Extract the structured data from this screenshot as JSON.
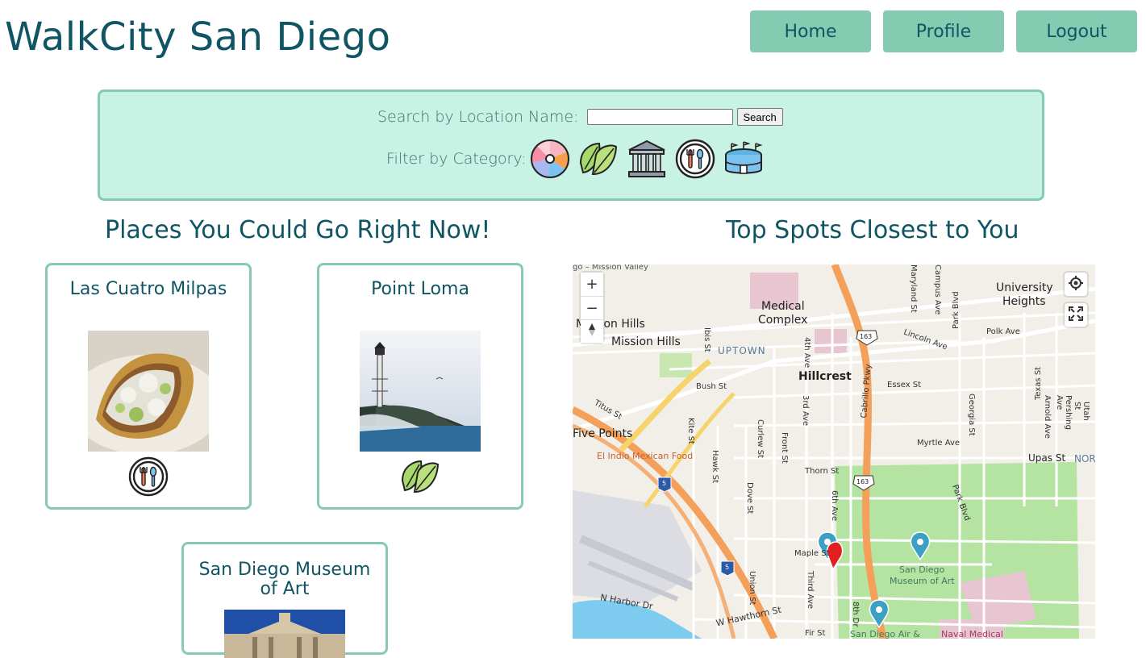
{
  "site": {
    "title": "WalkCity San Diego"
  },
  "nav": {
    "home": "Home",
    "profile": "Profile",
    "logout": "Logout"
  },
  "search": {
    "label": "Search by Location Name:",
    "button": "Search",
    "value": ""
  },
  "filter": {
    "label": "Filter by Category:",
    "categories": [
      "beach-ball-icon",
      "leaves-icon",
      "museum-icon",
      "restaurant-icon",
      "stadium-icon"
    ]
  },
  "sections": {
    "places": "Places You Could Go Right Now!",
    "top_spots": "Top Spots Closest to You"
  },
  "cards": [
    {
      "title": "Las Cuatro Milpas",
      "category": "restaurant-icon"
    },
    {
      "title": "Point Loma",
      "category": "leaves-icon"
    },
    {
      "title": "San Diego Museum of Art",
      "category": "museum-icon"
    }
  ],
  "map": {
    "zoom_in": "+",
    "zoom_out": "−",
    "labels": {
      "mission_valley": "go – Mission Valley",
      "medical": "Medical",
      "complex": "Complex",
      "university": "University",
      "heights": "Heights",
      "mission_hills_1": "Mission Hills",
      "mission_hills_2": "Mission Hills",
      "uptown": "UPTOWN",
      "hillcrest": "Hillcrest",
      "lincoln": "Lincoln Ave",
      "polk": "Polk Ave",
      "essex": "Essex St",
      "bush": "Bush St",
      "titus": "Titus St",
      "five_points": "Five Points",
      "el_indio": "El Indio Mexican Food",
      "myrtle": "Myrtle Ave",
      "upas": "Upas St",
      "nor": "NOR",
      "thorn": "Thorn St",
      "maple": "Maple St",
      "sd_museum_1": "San Diego",
      "sd_museum_2": "Museum of Art",
      "harbor": "N Harbor Dr",
      "hawthorn": "W Hawthorn St",
      "fir": "Fir St",
      "sd_air": "San Diego Air &",
      "naval": "Naval Medical",
      "park_blvd": "Park Blvd",
      "park_blvd2": "Park Blvd",
      "cabrillo": "Cabrillo Pkwy",
      "fourth": "4th Ave",
      "sixth": "6th Ave",
      "third": "3rd Ave",
      "front": "Front St",
      "kite": "Kite St",
      "hawk": "Hawk St",
      "dove": "Dove St",
      "curlew": "Curlew St",
      "union": "Union St",
      "third_ave": "Third Ave",
      "eighth": "8th Dr",
      "georgia": "Georgia St",
      "texas": "Texas St",
      "arnold": "Arnold Ave",
      "pershing": "Pershing Ave",
      "utah": "Utah St",
      "maryland": "Maryland St",
      "campus": "Campus Ave",
      "ibis": "Ibis St",
      "shield_163a": "163",
      "shield_163b": "163",
      "shield_5a": "5",
      "shield_5b": "5"
    }
  }
}
